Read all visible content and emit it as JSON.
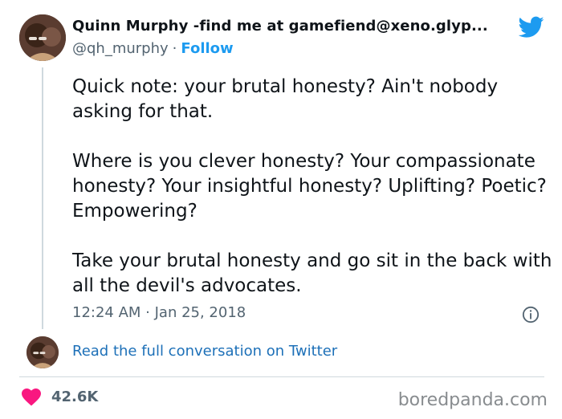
{
  "tweet": {
    "author_name": "Quinn Murphy -find me at gamefiend@xeno.glyp...",
    "handle": "@qh_murphy",
    "separator": "·",
    "follow_label": "Follow",
    "body": "Quick note: your brutal honesty? Ain't nobody asking for that.\n\nWhere is you clever honesty? Your compassionate honesty? Your insightful honesty? Uplifting? Poetic? Empowering?\n\nTake your brutal honesty and go sit in the back with all the devil's advocates.",
    "timestamp": "12:24 AM · Jan 25, 2018",
    "read_full_label": "Read the full conversation on Twitter",
    "likes": "42.6K"
  },
  "watermark": "boredpanda.com",
  "icons": {
    "brand": "twitter-bird-icon",
    "info": "info-icon",
    "like": "heart-icon"
  },
  "colors": {
    "accent": "#1d9bf0",
    "heart": "#f91880",
    "text": "#0f1419",
    "muted": "#536471"
  }
}
